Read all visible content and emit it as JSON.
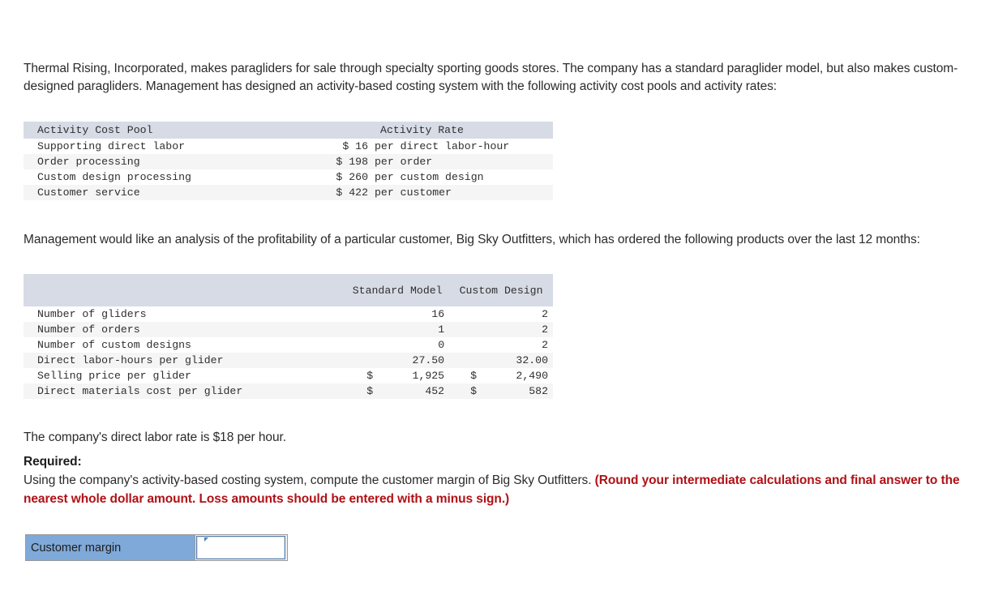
{
  "intro": {
    "paragraph": "Thermal Rising, Incorporated, makes paragliders for sale through specialty sporting goods stores. The company has a standard paraglider model, but also makes custom-designed paragliders. Management has designed an activity-based costing system with the following activity cost pools and activity rates:"
  },
  "activity_rate_table": {
    "headers": {
      "cost_pool": "Activity Cost Pool",
      "rate": "Activity Rate"
    },
    "rows": [
      {
        "pool": "Supporting direct labor",
        "amount": "$ 16",
        "unit": "per direct labor-hour"
      },
      {
        "pool": "Order processing",
        "amount": "$ 198",
        "unit": "per order"
      },
      {
        "pool": "Custom design processing",
        "amount": "$ 260",
        "unit": "per custom design"
      },
      {
        "pool": "Customer service",
        "amount": "$ 422",
        "unit": "per customer"
      }
    ]
  },
  "analysis": {
    "paragraph": "Management would like an analysis of the profitability of a particular customer, Big Sky Outfitters, which has ordered the following products over the last 12 months:"
  },
  "product_mix_table": {
    "headers": {
      "blank": "",
      "standard": "Standard Model",
      "custom": "Custom Design"
    },
    "rows": [
      {
        "label": "Number of gliders",
        "std_cur": "",
        "std": "16",
        "cus_cur": "",
        "cus": "2"
      },
      {
        "label": "Number of orders",
        "std_cur": "",
        "std": "1",
        "cus_cur": "",
        "cus": "2"
      },
      {
        "label": "Number of custom designs",
        "std_cur": "",
        "std": "0",
        "cus_cur": "",
        "cus": "2"
      },
      {
        "label": "Direct labor-hours per glider",
        "std_cur": "",
        "std": "27.50",
        "cus_cur": "",
        "cus": "32.00"
      },
      {
        "label": "Selling price per glider",
        "std_cur": "$",
        "std": "1,925",
        "cus_cur": "$",
        "cus": "2,490"
      },
      {
        "label": "Direct materials cost per glider",
        "std_cur": "$",
        "std": "452",
        "cus_cur": "$",
        "cus": "582"
      }
    ]
  },
  "labor_rate": {
    "paragraph": "The company's direct labor rate is $18 per hour."
  },
  "required": {
    "heading": "Required:",
    "body_normal": "Using the company's activity-based costing system, compute the customer margin of Big Sky Outfitters. ",
    "body_emphasis": "(Round your intermediate calculations and final answer to the nearest whole dollar amount. Loss amounts should be entered with a minus sign.)"
  },
  "answer": {
    "label": "Customer margin",
    "value": "",
    "placeholder": ""
  },
  "colors": {
    "table_header_bg": "#d6dbe5",
    "stripe_bg": "#f5f5f5",
    "emphasis_red": "#b01116",
    "answer_label_bg": "#7fa9d8",
    "input_border": "#5b7ea8"
  }
}
